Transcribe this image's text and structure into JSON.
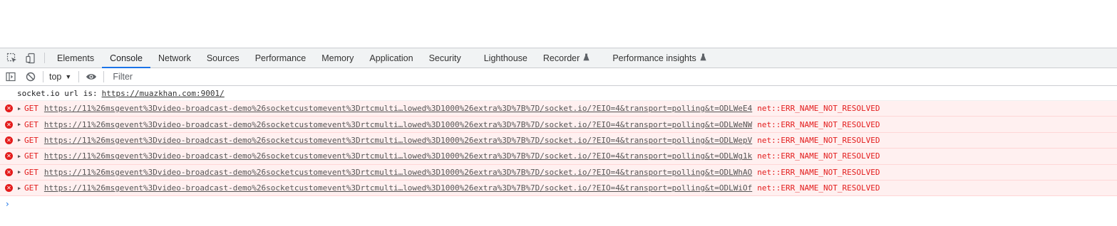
{
  "tabs": [
    {
      "label": "Elements"
    },
    {
      "label": "Console",
      "active": true
    },
    {
      "label": "Network"
    },
    {
      "label": "Sources"
    },
    {
      "label": "Performance"
    },
    {
      "label": "Memory"
    },
    {
      "label": "Application"
    },
    {
      "label": "Security"
    },
    {
      "label": "Lighthouse"
    },
    {
      "label": "Recorder",
      "experimental": true
    },
    {
      "label": "Performance insights",
      "experimental": true
    }
  ],
  "toolbar": {
    "context": "top",
    "filter_placeholder": "Filter"
  },
  "log": {
    "text": "socket.io url is:",
    "link": "https://muazkhan.com:9001/"
  },
  "errors": [
    {
      "method": "GET",
      "url": "https://11%26msgevent%3Dvideo-broadcast-demo%26socketcustomevent%3Drtcmulti…lowed%3D1000%26extra%3D%7B%7D/socket.io/?EIO=4&transport=polling&t=ODLWeE4",
      "message": "net::ERR_NAME_NOT_RESOLVED"
    },
    {
      "method": "GET",
      "url": "https://11%26msgevent%3Dvideo-broadcast-demo%26socketcustomevent%3Drtcmulti…lowed%3D1000%26extra%3D%7B%7D/socket.io/?EIO=4&transport=polling&t=ODLWeNW",
      "message": "net::ERR_NAME_NOT_RESOLVED"
    },
    {
      "method": "GET",
      "url": "https://11%26msgevent%3Dvideo-broadcast-demo%26socketcustomevent%3Drtcmulti…lowed%3D1000%26extra%3D%7B%7D/socket.io/?EIO=4&transport=polling&t=ODLWepV",
      "message": "net::ERR_NAME_NOT_RESOLVED"
    },
    {
      "method": "GET",
      "url": "https://11%26msgevent%3Dvideo-broadcast-demo%26socketcustomevent%3Drtcmulti…lowed%3D1000%26extra%3D%7B%7D/socket.io/?EIO=4&transport=polling&t=ODLWg1k",
      "message": "net::ERR_NAME_NOT_RESOLVED"
    },
    {
      "method": "GET",
      "url": "https://11%26msgevent%3Dvideo-broadcast-demo%26socketcustomevent%3Drtcmulti…lowed%3D1000%26extra%3D%7B%7D/socket.io/?EIO=4&transport=polling&t=ODLWhAO",
      "message": "net::ERR_NAME_NOT_RESOLVED"
    },
    {
      "method": "GET",
      "url": "https://11%26msgevent%3Dvideo-broadcast-demo%26socketcustomevent%3Drtcmulti…lowed%3D1000%26extra%3D%7B%7D/socket.io/?EIO=4&transport=polling&t=ODLWiOf",
      "message": "net::ERR_NAME_NOT_RESOLVED"
    }
  ],
  "prompt_symbol": "›",
  "icons": {
    "inspect": "inspect-element-icon",
    "device": "device-toolbar-icon",
    "sidebar": "show-sidebar-icon",
    "clear": "clear-console-icon",
    "eye": "live-expression-eye-icon",
    "error": "error-x-icon",
    "flask": "experiment-flask-icon"
  },
  "colors": {
    "accent": "#1a73e8",
    "error_text": "#e31c1c",
    "error_bg": "#fff0f0"
  }
}
